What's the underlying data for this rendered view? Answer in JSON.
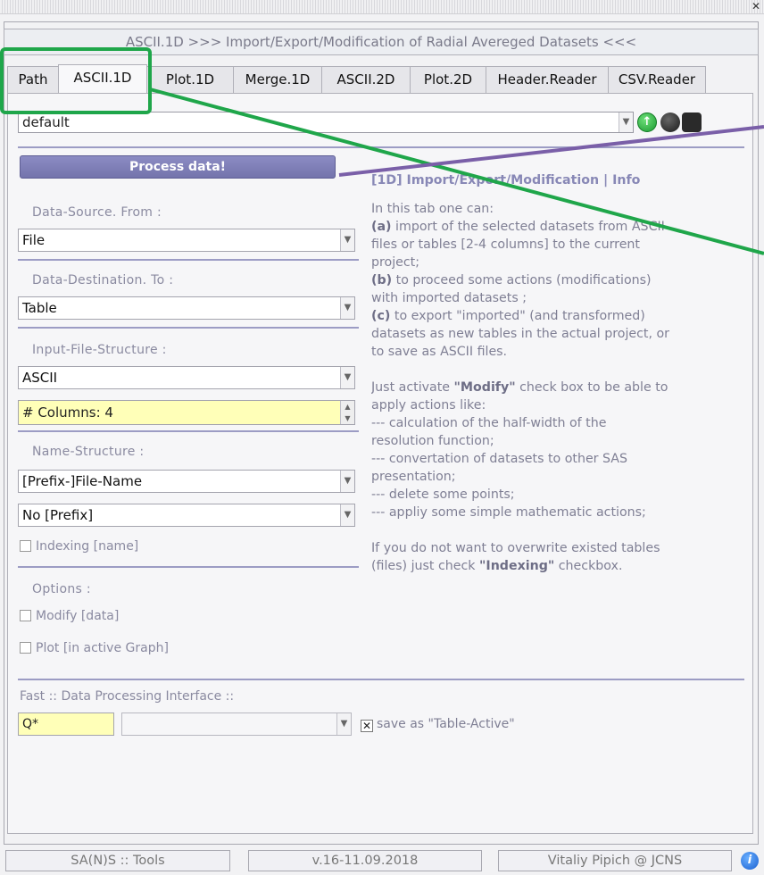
{
  "window": {
    "close_glyph": "✕"
  },
  "header": {
    "title": "ASCII.1D  >>> Import/Export/Modification of Radial Avereged Datasets <<<"
  },
  "tabs": [
    {
      "label": "Path"
    },
    {
      "label": "ASCII.1D",
      "active": true
    },
    {
      "label": "Plot.1D"
    },
    {
      "label": "Merge.1D"
    },
    {
      "label": "ASCII.2D"
    },
    {
      "label": "Plot.2D"
    },
    {
      "label": "Header.Reader"
    },
    {
      "label": "CSV.Reader"
    }
  ],
  "preset": {
    "value": "default"
  },
  "actions": {
    "process_label": "Process data!"
  },
  "form": {
    "source_label": "Data-Source. From :",
    "source_value": "File",
    "dest_label": "Data-Destination. To :",
    "dest_value": "Table",
    "structure_label": "Input-File-Structure :",
    "structure_value": "ASCII",
    "columns_value": "# Columns:  4",
    "name_label": "Name-Structure :",
    "name_value": "[Prefix-]File-Name",
    "prefix_value": "No [Prefix]",
    "indexing_label": "Indexing [name]",
    "options_label": "Options :",
    "modify_label": "Modify [data]",
    "plot_label": "Plot [in active Graph]"
  },
  "info": {
    "title": "[1D] Import/Export/Modification | Info",
    "para1": [
      "In this tab one can:",
      "(a) import of the selected datasets from ASCII",
      "files or tables [2-4 columns] to the current",
      "project;",
      "(b) to proceed some actions (modifications)",
      "with imported datasets ;",
      "(c) to export \"imported\" (and transformed)",
      "datasets as new tables in the actual project, or",
      "to save as ASCII files."
    ],
    "para2": [
      "Just activate \"Modify\" check box to be able to",
      "apply actions like:",
      "--- calculation of the half-width of the",
      "resolution function;",
      "--- convertation of datasets to other SAS",
      "presentation;",
      "--- delete some points;",
      "--- appliy some simple mathematic actions;"
    ],
    "para3": [
      "If you do not want to overwrite existed tables",
      "(files) just check \"Indexing\" checkbox."
    ]
  },
  "fast": {
    "label": "Fast :: Data Processing Interface ::",
    "input_value": "Q*",
    "combo_value": "",
    "save_label": "save as \"Table-Active\"",
    "save_checked": true
  },
  "statusbar": {
    "left": "SA(N)S :: Tools",
    "middle": "v.16-11.09.2018",
    "right": "Vitaliy Pipich @ JCNS"
  },
  "colors": {
    "accent": "#7c7cb6",
    "highlight_green": "#1fa64a",
    "pointer_purple": "#7a5fa8",
    "yellow_field": "#ffffb8"
  },
  "icons": [
    "close-icon",
    "chevron-down-icon",
    "green-arrow-icon",
    "record-icon",
    "save-icon",
    "info-icon"
  ]
}
